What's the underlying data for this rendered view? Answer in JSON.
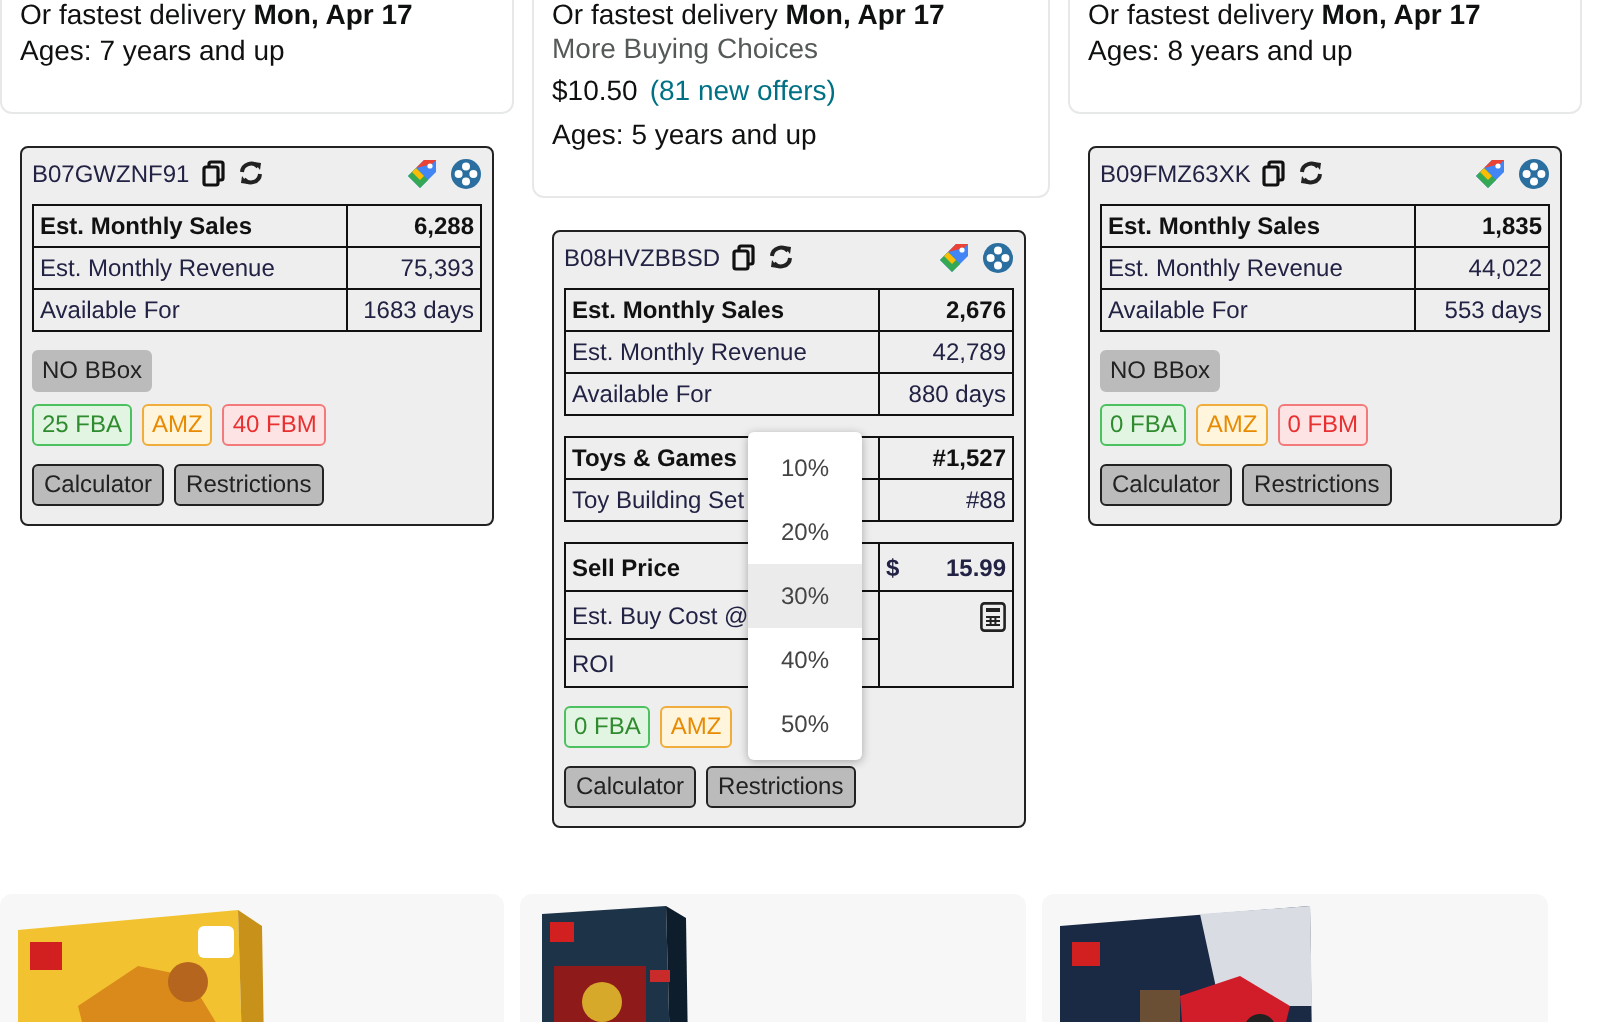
{
  "listings": [
    {
      "delivery": "Or fastest delivery **Mon, Apr 17**",
      "ages": "Ages: 7 years and up"
    },
    {
      "delivery": "Or fastest delivery **Mon, Apr 17**",
      "more_choices": "More Buying Choices",
      "price": "$10.50",
      "offers": "(81 new offers)",
      "ages": "Ages: 5 years and up"
    },
    {
      "delivery": "Or fastest delivery **Mon, Apr 17**",
      "ages": "Ages: 8 years and up"
    }
  ],
  "panels": [
    {
      "asin": "B07GWZNF91",
      "stats": [
        {
          "label": "Est. Monthly Sales",
          "value": "6,288",
          "bold": true
        },
        {
          "label": "Est. Monthly Revenue",
          "value": "75,393",
          "bold": false
        },
        {
          "label": "Available For",
          "value": "1683 days",
          "bold": false
        }
      ],
      "badges": [
        {
          "label": "NO BBox",
          "kind": "bbox"
        },
        {
          "label": "25 FBA",
          "kind": "fba"
        },
        {
          "label": "AMZ",
          "kind": "amz"
        },
        {
          "label": "40 FBM",
          "kind": "fbm"
        }
      ],
      "buttons": [
        "Calculator",
        "Restrictions"
      ]
    },
    {
      "asin": "B08HVZBBSD",
      "stats": [
        {
          "label": "Est. Monthly Sales",
          "value": "2,676",
          "bold": true
        },
        {
          "label": "Est. Monthly Revenue",
          "value": "42,789",
          "bold": false
        },
        {
          "label": "Available For",
          "value": "880 days",
          "bold": false
        }
      ],
      "ranks": [
        {
          "label": "Toys & Games",
          "value": "#1,527",
          "bold": true
        },
        {
          "label": "Toy Building Set",
          "value": "#88",
          "bold": false
        }
      ],
      "calculator": {
        "sell_label": "Sell Price",
        "currency": "$",
        "sell_value": "15.99",
        "buy_cost_label": "Est. Buy Cost @",
        "roi_label": "ROI"
      },
      "badges": [
        {
          "label": "0 FBA",
          "kind": "fba"
        },
        {
          "label": "AMZ",
          "kind": "amz"
        }
      ],
      "buttons": [
        "Calculator",
        "Restrictions"
      ],
      "dropdown": [
        {
          "label": "10%",
          "selected": false
        },
        {
          "label": "20%",
          "selected": false
        },
        {
          "label": "30%",
          "selected": true
        },
        {
          "label": "40%",
          "selected": false
        },
        {
          "label": "50%",
          "selected": false
        }
      ]
    },
    {
      "asin": "B09FMZ63XK",
      "stats": [
        {
          "label": "Est. Monthly Sales",
          "value": "1,835",
          "bold": true
        },
        {
          "label": "Est. Monthly Revenue",
          "value": "44,022",
          "bold": false
        },
        {
          "label": "Available For",
          "value": "553 days",
          "bold": false
        }
      ],
      "badges": [
        {
          "label": "NO BBox",
          "kind": "bbox"
        },
        {
          "label": "0 FBA",
          "kind": "fba"
        },
        {
          "label": "AMZ",
          "kind": "amz"
        },
        {
          "label": "0 FBM",
          "kind": "fbm"
        }
      ],
      "buttons": [
        "Calculator",
        "Restrictions"
      ]
    }
  ]
}
